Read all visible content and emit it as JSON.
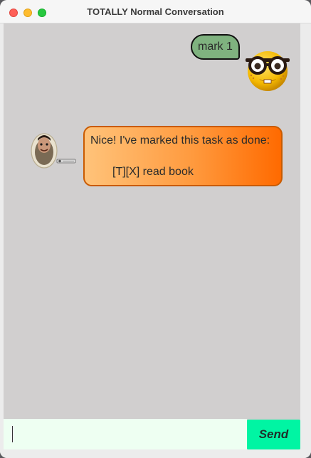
{
  "window": {
    "title": "TOTALLY Normal Conversation"
  },
  "messages": [
    {
      "sender": "user",
      "text": "mark 1",
      "bubble_color": "#7fb27f"
    },
    {
      "sender": "bot",
      "line1": "Nice! I've marked this task as done:",
      "line2": "[T][X] read book",
      "bubble_gradient": [
        "#ffc37a",
        "#ff6a00"
      ]
    }
  ],
  "input": {
    "value": "",
    "placeholder": ""
  },
  "send_button": {
    "label": "Send",
    "color": "#00f5a3"
  },
  "avatars": {
    "user": "nerd-emoji-avatar",
    "bot": "toilet-head-avatar"
  }
}
